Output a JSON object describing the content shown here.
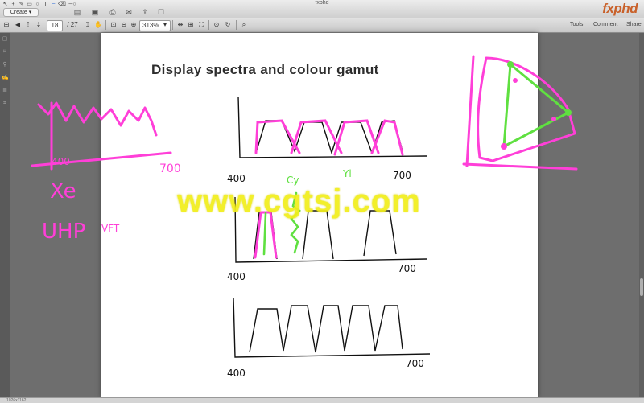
{
  "window": {
    "title": "fxphd"
  },
  "toolbar": {
    "create_label": "Create ▾",
    "tools_label": "Tools",
    "comment_label": "Comment",
    "share_label": "Share",
    "logo_text": "fxphd"
  },
  "navbar": {
    "current_page": "18",
    "total_pages": "/ 27",
    "zoom": "313%"
  },
  "document": {
    "title": "Display spectra and colour gamut",
    "axis_start": "400",
    "axis_end": "700",
    "annotations": {
      "cy": "Cy",
      "yl": "Yl",
      "xe": "Xe",
      "uhp": "UHP",
      "vft": "VFT",
      "left_axis_start": "400",
      "left_axis_end": "700"
    }
  },
  "watermark": "www.cgtsj.com",
  "status": {
    "text": "1026x1162"
  },
  "colors": {
    "ink_magenta": "#ff3fd8",
    "ink_green": "#5fe040",
    "watermark": "#f2ee1b",
    "logo": "#c9612a"
  },
  "icons": [
    "arrow-icon",
    "pen-icon",
    "shape-icon",
    "back-icon",
    "forward-icon",
    "print-icon",
    "hand-icon",
    "zoom-out-icon",
    "zoom-in-icon",
    "fit-page-icon",
    "search-icon"
  ]
}
